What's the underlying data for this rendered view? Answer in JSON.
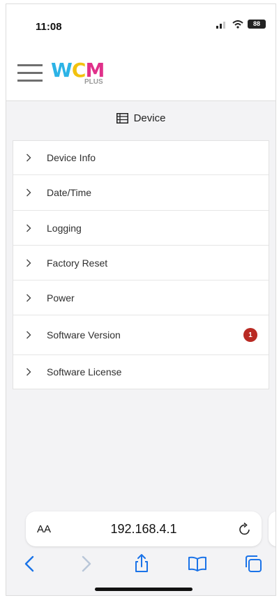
{
  "status_bar": {
    "time": "11:08",
    "battery": "88"
  },
  "header": {
    "logo_letters": [
      {
        "char": "W",
        "color": "#2cb3e6"
      },
      {
        "char": "C",
        "color": "#f2c20f"
      },
      {
        "char": "M",
        "color": "#e0308a"
      }
    ],
    "logo_sub": "PLUS"
  },
  "page": {
    "title": "Device"
  },
  "menu": {
    "items": [
      {
        "label": "Device Info"
      },
      {
        "label": "Date/Time"
      },
      {
        "label": "Logging"
      },
      {
        "label": "Factory Reset"
      },
      {
        "label": "Power"
      },
      {
        "label": "Software Version",
        "badge": "1"
      },
      {
        "label": "Software License"
      }
    ]
  },
  "browser": {
    "text_size_label": "AA",
    "url": "192.168.4.1"
  },
  "colors": {
    "badge": "#b92a23",
    "toolbar_active": "#1a73e8",
    "toolbar_disabled": "#b9c6d8"
  },
  "icons": {
    "page_title": "list-icon",
    "item_chevron": "chevron-right-icon",
    "reload": "reload-icon",
    "toolbar": [
      "back-icon",
      "forward-icon",
      "share-icon",
      "bookmarks-icon",
      "tabs-icon"
    ]
  }
}
